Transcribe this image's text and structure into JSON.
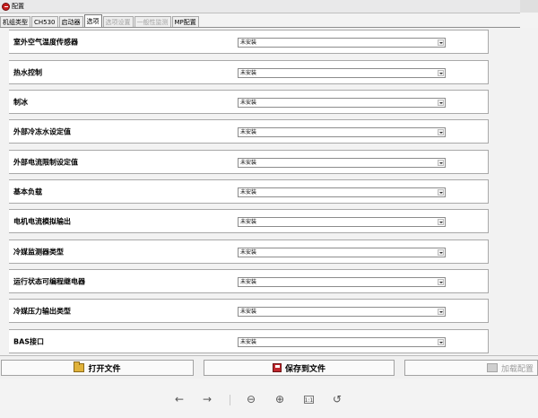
{
  "window": {
    "title": "配置"
  },
  "tabs": [
    {
      "label": "机组类型",
      "state": "normal"
    },
    {
      "label": "CH530",
      "state": "normal"
    },
    {
      "label": "启动器",
      "state": "normal"
    },
    {
      "label": "选项",
      "state": "active"
    },
    {
      "label": "选项设置",
      "state": "disabled"
    },
    {
      "label": "一般性监测",
      "state": "disabled"
    },
    {
      "label": "MP配置",
      "state": "normal"
    }
  ],
  "options": [
    {
      "label": "室外空气温度传感器",
      "value": "未安装"
    },
    {
      "label": "热水控制",
      "value": "未安装"
    },
    {
      "label": "制冰",
      "value": "未安装"
    },
    {
      "label": "外部冷冻水设定值",
      "value": "未安装"
    },
    {
      "label": "外部电流限制设定值",
      "value": "未安装"
    },
    {
      "label": "基本负载",
      "value": "未安装"
    },
    {
      "label": "电机电流模拟输出",
      "value": "未安装"
    },
    {
      "label": "冷媒监测器类型",
      "value": "未安装"
    },
    {
      "label": "运行状态可编程继电器",
      "value": "未安装"
    },
    {
      "label": "冷媒压力输出类型",
      "value": "未安装"
    },
    {
      "label": "BAS接口",
      "value": "未安装"
    }
  ],
  "buttons": {
    "open": "打开文件",
    "save": "保存到文件",
    "load": "加载配置"
  },
  "viewer": {
    "back": "←",
    "forward": "→",
    "zoom_out": "⊖",
    "zoom_in": "⊕",
    "actual_size": "1:1",
    "rotate": "↺"
  },
  "icons": {
    "app": "chiller-app-icon",
    "open": "folder-icon",
    "save": "floppy-disk-icon",
    "load": "load-config-icon"
  }
}
